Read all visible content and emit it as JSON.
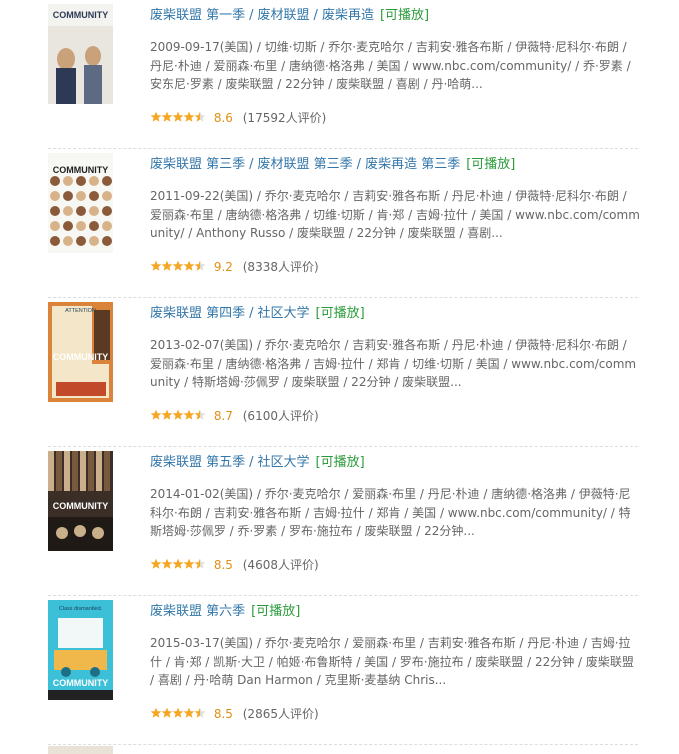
{
  "results": [
    {
      "title": "废柴联盟 第一季",
      "aliases": [
        "废材联盟",
        "废柴再造"
      ],
      "playable": "[可播放]",
      "meta": "2009-09-17(美国) / 切维·切斯 / 乔尔·麦克哈尔 / 吉莉安·雅各布斯 / 伊薇特·尼科尔·布朗 / 丹尼·朴迪 / 爱丽森·布里 / 唐纳德·格洛弗 / 美国 / www.nbc.com/community/ / 乔·罗素 / 安东尼·罗素 / 废柴联盟 / 22分钟 / 废柴联盟 / 喜剧 / 丹·哈萌...",
      "score": "8.6",
      "votes": "(17592人评价)",
      "stars": 4.5,
      "poster": {
        "palette": [
          "#f3f3ef",
          "#2e3a55",
          "#c9a27a",
          "#5c6a82"
        ],
        "label": "COMMUNITY"
      }
    },
    {
      "title": "废柴联盟 第三季",
      "aliases": [
        "废材联盟 第三季",
        "废柴再造 第三季"
      ],
      "playable": "[可播放]",
      "meta": "2011-09-22(美国) / 乔尔·麦克哈尔 / 吉莉安·雅各布斯 / 丹尼·朴迪 / 伊薇特·尼科尔·布朗 / 爱丽森·布里 / 唐纳德·格洛弗 / 切维·切斯 / 肯·郑 / 吉姆·拉什 / 美国 / www.nbc.com/community/ / Anthony Russo / 废柴联盟 / 22分钟 / 废柴联盟 / 喜剧...",
      "score": "9.2",
      "votes": "(8338人评价)",
      "stars": 4.5,
      "poster": {
        "palette": [
          "#f7f7f4",
          "#1f1f1f",
          "#d8b38a",
          "#8a5a3a"
        ],
        "label": "COMMUNITY"
      }
    },
    {
      "title": "废柴联盟 第四季",
      "aliases": [
        "社区大学"
      ],
      "playable": "[可播放]",
      "meta": "2013-02-07(美国) / 乔尔·麦克哈尔 / 吉莉安·雅各布斯 / 丹尼·朴迪 / 伊薇特·尼科尔·布朗 / 爱丽森·布里 / 唐纳德·格洛弗 / 吉姆·拉什 / 郑肯 / 切维·切斯 / 美国 / www.nbc.com/community / 特斯塔姆·莎佩罗 / 废柴联盟 / 22分钟 / 废柴联盟...",
      "score": "8.7",
      "votes": "(6100人评价)",
      "stars": 4.5,
      "poster": {
        "palette": [
          "#d9843a",
          "#f4e6c8",
          "#5a3a22",
          "#c24a2a"
        ],
        "label": "COMMUNITY",
        "top": "ATTENTION"
      }
    },
    {
      "title": "废柴联盟 第五季",
      "aliases": [
        "社区大学"
      ],
      "playable": "[可播放]",
      "meta": "2014-01-02(美国) / 乔尔·麦克哈尔 / 爱丽森·布里 / 丹尼·朴迪 / 唐纳德·格洛弗 / 伊薇特·尼科尔·布朗 / 吉莉安·雅各布斯 / 吉姆·拉什 / 郑肯 / 美国 / www.nbc.com/community/ / 特斯塔姆·莎佩罗 / 乔·罗素 / 罗布·施拉布 / 废柴联盟 / 22分钟...",
      "score": "8.5",
      "votes": "(4608人评价)",
      "stars": 4.5,
      "poster": {
        "palette": [
          "#3a2e26",
          "#7a5a3e",
          "#c9b08a",
          "#1f1a16"
        ],
        "label": "COMMUNITY"
      }
    },
    {
      "title": "废柴联盟 第六季",
      "aliases": [],
      "playable": "[可播放]",
      "meta": "2015-03-17(美国) / 乔尔·麦克哈尔 / 爱丽森·布里 / 吉莉安·雅各布斯 / 丹尼·朴迪 / 吉姆·拉什 / 肯·郑 / 凯斯·大卫 / 帕姬·布鲁斯特 / 美国 / 罗布·施拉布 / 废柴联盟 / 22分钟 / 废柴联盟 / 喜剧 / 丹·哈萌 Dan Harmon / 克里斯·麦基纳 Chris...",
      "score": "8.5",
      "votes": "(2865人评价)",
      "stars": 4.5,
      "poster": {
        "palette": [
          "#3cc0d8",
          "#f2f7f8",
          "#1e6f86",
          "#f0b84a"
        ],
        "label": "COMMUNITY",
        "top": "Class dismantled."
      }
    }
  ],
  "colors": {
    "link": "#3377aa",
    "playable": "#2b9c3b",
    "score": "#e09015",
    "star": "#f5a623",
    "star_empty": "#dddddd"
  }
}
